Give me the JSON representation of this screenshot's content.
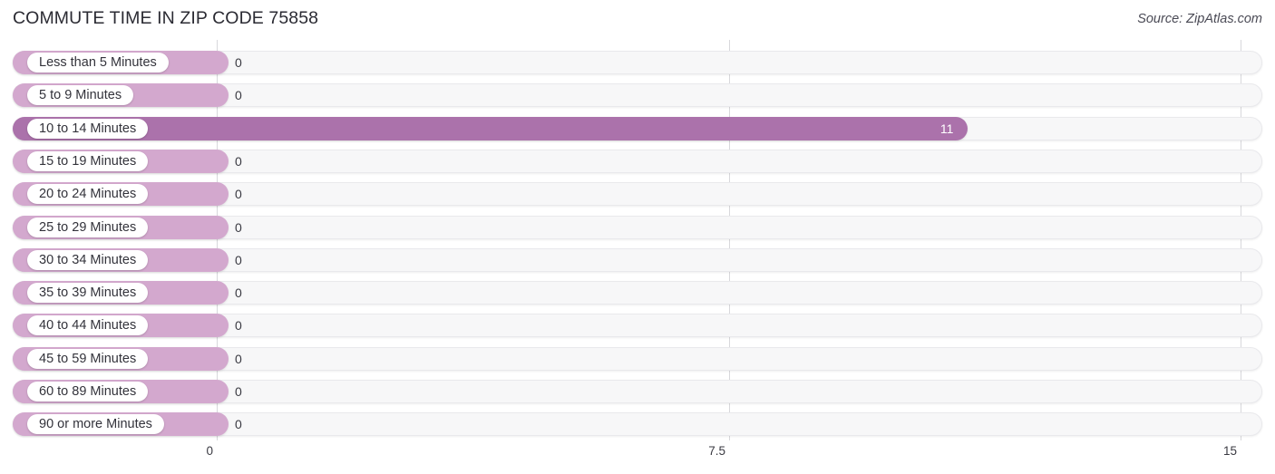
{
  "header": {
    "title": "COMMUTE TIME IN ZIP CODE 75858",
    "source": "Source: ZipAtlas.com"
  },
  "chart_data": {
    "type": "bar",
    "orientation": "horizontal",
    "title": "COMMUTE TIME IN ZIP CODE 75858",
    "subtitle": "Source: ZipAtlas.com",
    "xlabel": "",
    "ylabel": "",
    "xlim": [
      0,
      15
    ],
    "grid": true,
    "legend": null,
    "axis_ticks": [
      "0",
      "7.5",
      "15"
    ],
    "axis_tick_values": [
      0,
      7.5,
      15
    ],
    "categories": [
      "Less than 5 Minutes",
      "5 to 9 Minutes",
      "10 to 14 Minutes",
      "15 to 19 Minutes",
      "20 to 24 Minutes",
      "25 to 29 Minutes",
      "30 to 34 Minutes",
      "35 to 39 Minutes",
      "40 to 44 Minutes",
      "45 to 59 Minutes",
      "60 to 89 Minutes",
      "90 or more Minutes"
    ],
    "values": [
      0,
      0,
      11,
      0,
      0,
      0,
      0,
      0,
      0,
      0,
      0,
      0
    ],
    "value_labels": [
      "0",
      "0",
      "11",
      "0",
      "0",
      "0",
      "0",
      "0",
      "0",
      "0",
      "0",
      "0"
    ],
    "highlighted_index": 2,
    "colors": {
      "bar": "#d3a8ce",
      "bar_highlight": "#ab72ab",
      "track": "#f7f7f8",
      "track_border": "#e9e9ec",
      "gridline": "#d8d8dc",
      "label_pill": "#ffffff",
      "text": "#33333b",
      "value_text_inside": "#ffffff"
    }
  }
}
